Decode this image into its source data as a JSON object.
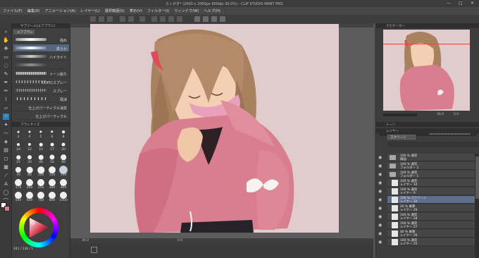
{
  "window": {
    "title": "らくがき* (2000 x 2000px 600dpi 30.0%) - CLIP STUDIO PAINT PRO",
    "minimize": "—",
    "maximize": "□",
    "close": "✕"
  },
  "menu": [
    "ファイル(F)",
    "編集(E)",
    "アニメーション(A)",
    "レイヤー(L)",
    "選択範囲(S)",
    "表示(V)",
    "フィルター(I)",
    "ウィンドウ(W)",
    "ヘルプ(H)"
  ],
  "brush_panel": {
    "header": "サブツール[エアブラシ]",
    "tab_label": "エアブラシ",
    "brushes": [
      "強め",
      "柔らか",
      "ハイライト",
      "",
      "トーン削り",
      "COPICスプレー",
      "スプレー",
      "飛沫",
      "仕上げパーティクル消去",
      "仕上げパーティクル"
    ]
  },
  "size_panel": {
    "header": "ブラシサイズ",
    "sizes": [
      "3",
      "4",
      "5",
      "6",
      "8",
      "10",
      "12",
      "15",
      "17",
      "20",
      "25",
      "30",
      "40",
      "50",
      "60",
      "70",
      "80",
      "100",
      "120",
      "150",
      "170",
      "200",
      "250",
      "300",
      "400",
      "500",
      "600",
      "700",
      "800",
      "1000"
    ]
  },
  "canvas": {
    "zoom": "30.0",
    "angle": "0.0",
    "coords": "241 / 136 / 1"
  },
  "navigator": {
    "tab_label": "ナビゲーター",
    "zoom": "30.0",
    "angle": "0.0"
  },
  "tone_panel": {
    "tab_label": "トーン",
    "opacity": "100"
  },
  "layers_panel": {
    "tab_label": "レイヤー",
    "blend_mode": "スクリーン",
    "layers": [
      {
        "line1": "100 % 通常",
        "line2": "線画",
        "type": "folder",
        "selected": false
      },
      {
        "line1": "100 % 通常",
        "line2": "フォルダー 2",
        "type": "folder",
        "selected": false
      },
      {
        "line1": "100 % 通常",
        "line2": "フォルダー 1",
        "type": "folder",
        "selected": false
      },
      {
        "line1": "100 % 通常",
        "line2": "レイヤー 10",
        "type": "layer",
        "selected": false
      },
      {
        "line1": "100 % 通常",
        "line2": "レイヤー 9",
        "type": "layer",
        "selected": false
      },
      {
        "line1": "100 % スクリーン",
        "line2": "レイヤー 30",
        "type": "layer",
        "selected": true
      },
      {
        "line1": "20 % 乗算",
        "line2": "レイヤー 29",
        "type": "layer",
        "selected": false
      },
      {
        "line1": "100 % 通常",
        "line2": "レイヤー 28",
        "type": "layer",
        "selected": false
      },
      {
        "line1": "100 % 通常",
        "line2": "レイヤー 27",
        "type": "layer",
        "selected": false
      },
      {
        "line1": "40 % 乗算",
        "line2": "レイヤー 26",
        "type": "layer",
        "selected": false
      },
      {
        "line1": "100 % 通常",
        "line2": "レイヤー 25",
        "type": "layer",
        "selected": false
      }
    ]
  },
  "colors": {
    "accent": "#2f7fb0",
    "canvas_bg": "#e0cccc",
    "hoodie": "#d97e8e",
    "hair": "#b38a6a",
    "selected_layer": "#5e6e8a"
  }
}
